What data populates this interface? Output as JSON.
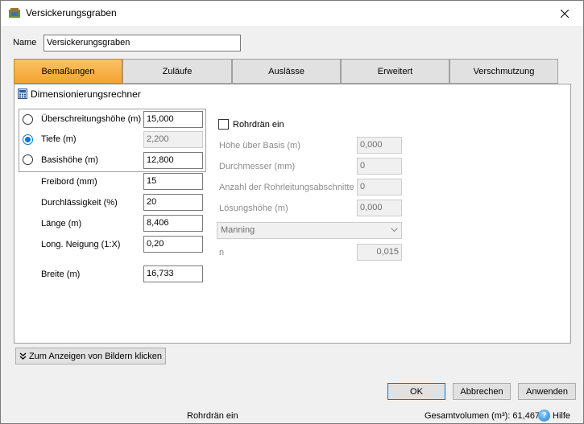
{
  "window": {
    "title": "Versickerungsgraben"
  },
  "name_field": {
    "label": "Name",
    "value": "Versickerungsgraben"
  },
  "tabs": [
    {
      "label": "Bemaßungen",
      "active": true
    },
    {
      "label": "Zuläufe",
      "active": false
    },
    {
      "label": "Auslässe",
      "active": false
    },
    {
      "label": "Erweitert",
      "active": false
    },
    {
      "label": "Verschmutzung",
      "active": false
    }
  ],
  "calculator": {
    "title": "Dimensionierungsrechner"
  },
  "radio_fields": [
    {
      "label": "Überschreitungshöhe (m)",
      "value": "15,000",
      "checked": false,
      "disabled": false
    },
    {
      "label": "Tiefe (m)",
      "value": "2,200",
      "checked": true,
      "disabled": true
    },
    {
      "label": "Basishöhe (m)",
      "value": "12,800",
      "checked": false,
      "disabled": false
    }
  ],
  "fields": {
    "freibord": {
      "label": "Freibord (mm)",
      "value": "15"
    },
    "durchlaessigkeit": {
      "label": "Durchlässigkeit (%)",
      "value": "20"
    },
    "laenge": {
      "label": "Länge (m)",
      "value": "8,406"
    },
    "neigung": {
      "label": "Long. Neigung (1:X)",
      "value": "0,20"
    },
    "breite": {
      "label": "Breite (m)",
      "value": "16,733"
    }
  },
  "rohrdraen": {
    "checkbox_label": "Rohrdrän ein",
    "checked": false,
    "hoehe": {
      "label": "Höhe über Basis (m)",
      "value": "0,000"
    },
    "durchmesser": {
      "label": "Durchmesser (mm)",
      "value": "0"
    },
    "anzahl": {
      "label": "Anzahl der Rohrleitungsabschnitte",
      "value": "0"
    },
    "loesungshoehe": {
      "label": "Lösungshöhe (m)",
      "value": "0,000"
    },
    "method": {
      "selected": "Manning"
    },
    "n": {
      "label": "n",
      "value": "0,015"
    }
  },
  "images_button": {
    "label": "Zum Anzeigen von Bildern klicken"
  },
  "buttons": {
    "ok": "OK",
    "cancel": "Abbrechen",
    "apply": "Anwenden"
  },
  "status": {
    "left": "Rohrdrän ein",
    "volume": "Gesamtvolumen (m³): 61,467",
    "help": "Hilfe"
  },
  "colors": {
    "active_tab": "#f5a530",
    "accent": "#0078d7"
  }
}
